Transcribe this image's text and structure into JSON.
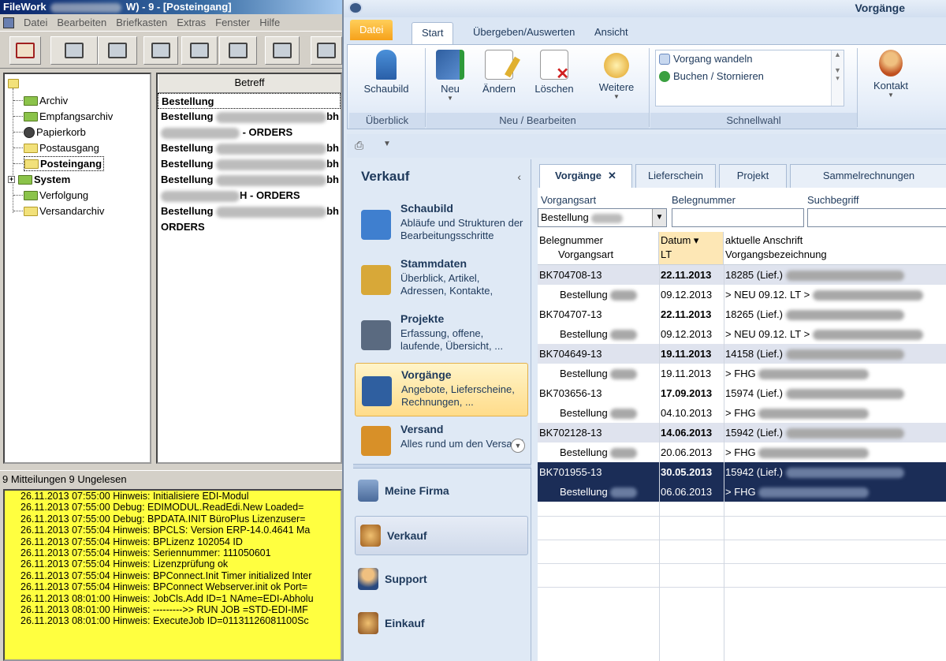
{
  "filework": {
    "title_prefix": "FileWork",
    "title_suffix": "W) - 9 - [Posteingang]",
    "menu": [
      "Datei",
      "Bearbeiten",
      "Briefkasten",
      "Extras",
      "Fenster",
      "Hilfe"
    ],
    "tree": [
      {
        "label": "Archiv",
        "bold": false
      },
      {
        "label": "Empfangsarchiv",
        "bold": false
      },
      {
        "label": "Papierkorb",
        "bold": false
      },
      {
        "label": "Postausgang",
        "bold": false
      },
      {
        "label": "Posteingang",
        "bold": true
      },
      {
        "label": "System",
        "bold": true
      },
      {
        "label": "Verfolgung",
        "bold": false
      },
      {
        "label": "Versandarchiv",
        "bold": false
      }
    ],
    "list_header": "Betreff",
    "list_rows": [
      {
        "text": "Bestellung",
        "tail": ""
      },
      {
        "text": "Bestellung",
        "tail": "bh"
      },
      {
        "text": "",
        "tail": " - ORDERS"
      },
      {
        "text": "Bestellung",
        "tail": "bh"
      },
      {
        "text": "Bestellung",
        "tail": "bh"
      },
      {
        "text": "Bestellung",
        "tail": "bh"
      },
      {
        "text": "",
        "tail": "H - ORDERS"
      },
      {
        "text": "Bestellung",
        "tail": "bh"
      },
      {
        "text": "ORDERS",
        "tail": ""
      }
    ],
    "status": "9 Mitteilungen 9 Ungelesen",
    "log": [
      "26.11.2013 07:55:00 Hinweis:   Initialisiere EDI-Modul",
      "26.11.2013 07:55:00 Debug:     EDIMODUL.ReadEdi.New Loaded=",
      "26.11.2013 07:55:00 Debug:     BPDATA.INIT BüroPlus Lizenzuser=",
      "26.11.2013 07:55:04 Hinweis:   BPCLS: Version ERP-14.0.4641 Ma",
      "26.11.2013 07:55:04 Hinweis:   BPLizenz 102054                 ID",
      "26.11.2013 07:55:04 Hinweis:   Seriennummer: 111050601",
      "26.11.2013 07:55:04 Hinweis:   Lizenzprüfung ok",
      "26.11.2013 07:55:04 Hinweis:   BPConnect.Init Timer initialized Inter",
      "26.11.2013 07:55:04 Hinweis:   BPConnect Webserver.init ok Port=",
      "26.11.2013 08:01:00 Hinweis:   JobCls.Add ID=1 NAme=EDI-Abholu",
      "26.11.2013 08:01:00 Hinweis:   --------->> RUN JOB =STD-EDI-IMF",
      "26.11.2013 08:01:00 Hinweis:   ExecuteJob ID=01131126081100Sc"
    ]
  },
  "buroplus": {
    "title": "Vorgänge",
    "ribbon_tabs": [
      "Datei",
      "Start",
      "Übergeben/Auswerten",
      "Ansicht"
    ],
    "ribbon_buttons": {
      "schaubild": "Schaubild",
      "neu": "Neu",
      "aendern": "Ändern",
      "loeschen": "Löschen",
      "weitere": "Weitere",
      "kontakt": "Kontakt"
    },
    "schnellwahl_items": [
      "Vorgang wandeln",
      "Buchen / Stornieren"
    ],
    "group_labels": [
      "Überblick",
      "Neu / Bearbeiten",
      "Schnellwahl"
    ],
    "nav": {
      "header": "Verkauf",
      "items": [
        {
          "title": "Schaubild",
          "desc": "Abläufe und Strukturen der Bearbeitungsschritte",
          "color": "#3f7fcf"
        },
        {
          "title": "Stammdaten",
          "desc": "Überblick, Artikel, Adressen, Kontakte,",
          "color": "#d8a838"
        },
        {
          "title": "Projekte",
          "desc": "Erfassung, offene, laufende, Übersicht, ...",
          "color": "#5a6a80"
        },
        {
          "title": "Vorgänge",
          "desc": "Angebote, Lieferscheine, Rechnungen, ...",
          "color": "#2f5fa0"
        },
        {
          "title": "Versand",
          "desc": "Alles rund um den Versand",
          "color": "#d89028"
        }
      ],
      "buttons": [
        "Meine Firma",
        "Verkauf",
        "Support",
        "Einkauf"
      ]
    },
    "doc_tabs": [
      "Vorgänge",
      "Lieferschein",
      "Projekt",
      "Sammelrechnungen"
    ],
    "filters": {
      "vorgangsart_label": "Vorgangsart",
      "vorgangsart_value": "Bestellung",
      "belegnummer_label": "Belegnummer",
      "suchbegriff_label": "Suchbegriff"
    },
    "grid_headers": {
      "c1a": "Belegnummer",
      "c1b": "Vorgangsart",
      "c2a": "Datum ▾",
      "c2b": "LT",
      "c3a": "aktuelle Anschrift",
      "c3b": "Vorgangsbezeichnung"
    },
    "rows": [
      {
        "beleg": "BK704708-13",
        "art": "Bestellung",
        "datum": "22.11.2013",
        "lt": "09.12.2013",
        "anschrift": "18285 (Lief.)",
        "bez": "> NEU 09.12. LT >"
      },
      {
        "beleg": "BK704707-13",
        "art": "Bestellung",
        "datum": "22.11.2013",
        "lt": "09.12.2013",
        "anschrift": "18265 (Lief.)",
        "bez": "> NEU 09.12. LT >"
      },
      {
        "beleg": "BK704649-13",
        "art": "Bestellung",
        "datum": "19.11.2013",
        "lt": "19.11.2013",
        "anschrift": "14158 (Lief.)",
        "bez": "> FHG"
      },
      {
        "beleg": "BK703656-13",
        "art": "Bestellung",
        "datum": "17.09.2013",
        "lt": "04.10.2013",
        "anschrift": "15974 (Lief.)",
        "bez": "> FHG"
      },
      {
        "beleg": "BK702128-13",
        "art": "Bestellung",
        "datum": "14.06.2013",
        "lt": "20.06.2013",
        "anschrift": "15942 (Lief.)",
        "bez": "> FHG"
      },
      {
        "beleg": "BK701955-13",
        "art": "Bestellung",
        "datum": "30.05.2013",
        "lt": "06.06.2013",
        "anschrift": "15942 (Lief.)",
        "bez": "> FHG"
      }
    ]
  }
}
